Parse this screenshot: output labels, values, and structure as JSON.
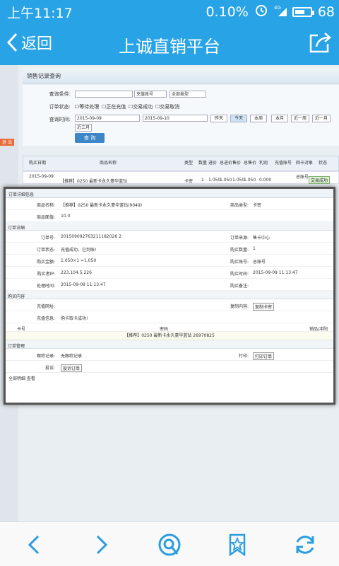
{
  "status": {
    "time": "上午11:17",
    "data_rate": "0.10%",
    "battery": "68",
    "battery_level": 0.68
  },
  "nav": {
    "back_label": "返回",
    "title": "上诚直销平台"
  },
  "page": {
    "panel_title": "销售记录查询",
    "left_tab": "退 出",
    "query": {
      "condition_label": "查询条件:",
      "condition_select": "充值账号",
      "type_select": "全部类型",
      "status_label": "订单状态:",
      "status_options": [
        "等待处理",
        "正在充值",
        "交易成功",
        "交易取消"
      ],
      "time_label": "查询时间:",
      "date_from": "2015-09-09",
      "date_to": "2015-09-10",
      "quick_ranges": [
        "昨天",
        "今天",
        "本周",
        "本月",
        "近一周",
        "近一月",
        "近三月"
      ],
      "search_button": "查 询"
    },
    "grid": {
      "headers": [
        "购买日期",
        "商品名称",
        "类型",
        "数量",
        "进价",
        "总进价",
        "售价",
        "总售价",
        "利润",
        "充值账号",
        "回卡对象",
        "状态"
      ],
      "row": {
        "date": "2015-09-09",
        "product": "【推荐】0250 最新卡永久豪华蓝钻",
        "type": "卡密",
        "qty": "1",
        "price": "1.050",
        "total": "1.050",
        "sale": "1.050",
        "total_sale": "1.050",
        "profit": "0.000",
        "target": "总账号",
        "status": "交易成功"
      }
    }
  },
  "modal": {
    "title": "订单详细信息",
    "product_name_label": "商品名称:",
    "product_name": "【推荐】0250 最新卡永久豪华蓝钻(9049)",
    "product_type_label": "商品类型:",
    "product_type": "卡密",
    "face_value_label": "商品面值:",
    "face_value": "10.0",
    "section_order": "订单详细",
    "order_no_label": "订单号:",
    "order_no": "201509092763211182026 2",
    "order_source_label": "订单来源:",
    "order_source": "售卡中心",
    "order_status_label": "订单状态:",
    "order_status": "充值成功，已到账!",
    "buy_qty_label": "购买数量:",
    "buy_qty": "1",
    "buy_amount_label": "购买金额:",
    "buy_amount": "1.050×1 =1.050",
    "buy_account_label": "购买账号:",
    "buy_account": "总账号",
    "buyer_ip_label": "购买者IP:",
    "buyer_ip": "223.104.5.226",
    "buy_time_label": "购买时间:",
    "buy_time": "2015-09-09 11:13:47",
    "process_time_label": "处理时间:",
    "process_time": "2015-09-09 11:13:47",
    "buy_note_label": "购买备注:",
    "buy_note": "",
    "section_content": "购买内容",
    "recharge_url_label": "充值网址:",
    "recharge_url": "",
    "copy_label": "复制内容:",
    "copy_button": "复制卡密",
    "recharge_info_label": "充值信息:",
    "recharge_info": "购卡取卡成功!",
    "card_headers": [
      "卡号",
      "密码",
      "销品/冲阳"
    ],
    "card_row": "【推荐】0250 最新卡永久豪华蓝钻 26970825",
    "section_manage": "订单管理",
    "track_label": "跟踪记录:",
    "track_value": "无跟踪记录",
    "print_label": "打印:",
    "print_button": "打印订单",
    "complain_label": "投诉:",
    "complain_button": "投诉订单",
    "footer": "全部明细 查看"
  },
  "colors": {
    "brand": "#27a3e6",
    "toolbar_icon": "#2a9de0"
  }
}
